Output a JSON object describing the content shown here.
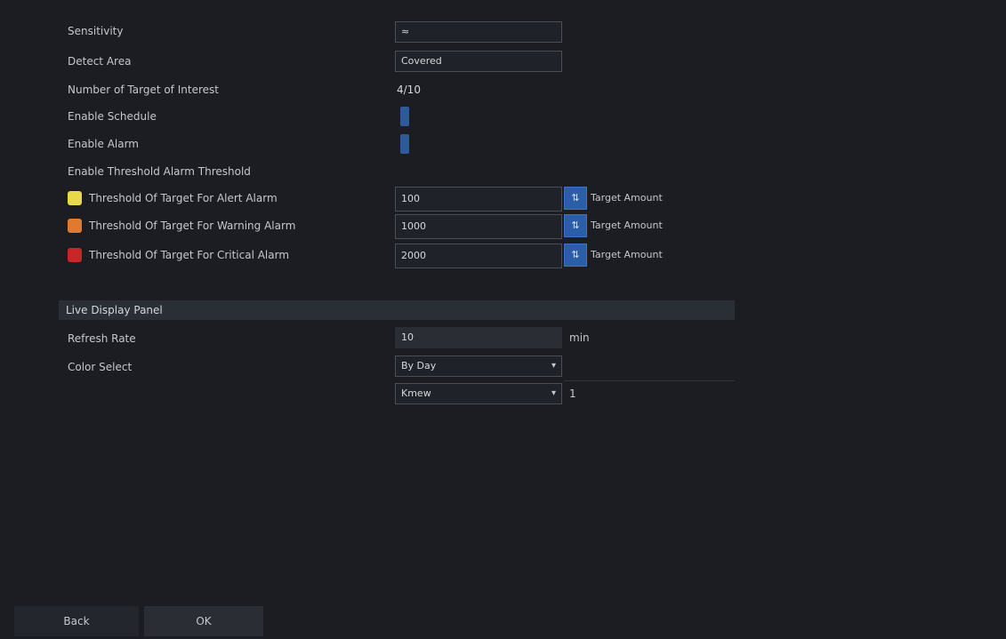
{
  "rows": [
    {
      "label": "Sensitivity",
      "value": "≈"
    },
    {
      "label": "Detect Area",
      "value": "Covered"
    },
    {
      "label": "Number of Target of Interest",
      "value": "4/10"
    },
    {
      "label": "Enable Schedule",
      "toggle": true
    },
    {
      "label": "Enable Alarm",
      "toggle": true
    }
  ],
  "threshold_header": "Enable Threshold Alarm Threshold",
  "thresholds": [
    {
      "label": "Threshold Of Target For Alert Alarm",
      "value": "100",
      "note": "Target Amount",
      "color": "#e8d84a"
    },
    {
      "label": "Threshold Of Target For Warning Alarm",
      "value": "1000",
      "note": "Target Amount",
      "color": "#e07a2e"
    },
    {
      "label": "Threshold Of Target For Critical Alarm",
      "value": "2000",
      "note": "Target Amount",
      "color": "#c92727"
    }
  ],
  "section": {
    "title": "Live Display Panel"
  },
  "display": {
    "refresh_label": "Refresh Rate",
    "refresh_value": "10",
    "refresh_unit": "min",
    "color_label": "Color Select",
    "color_value": "By Day",
    "second_value": "Kmew",
    "second_extra": "1"
  },
  "buttons": {
    "left": "Back",
    "right": "OK"
  }
}
